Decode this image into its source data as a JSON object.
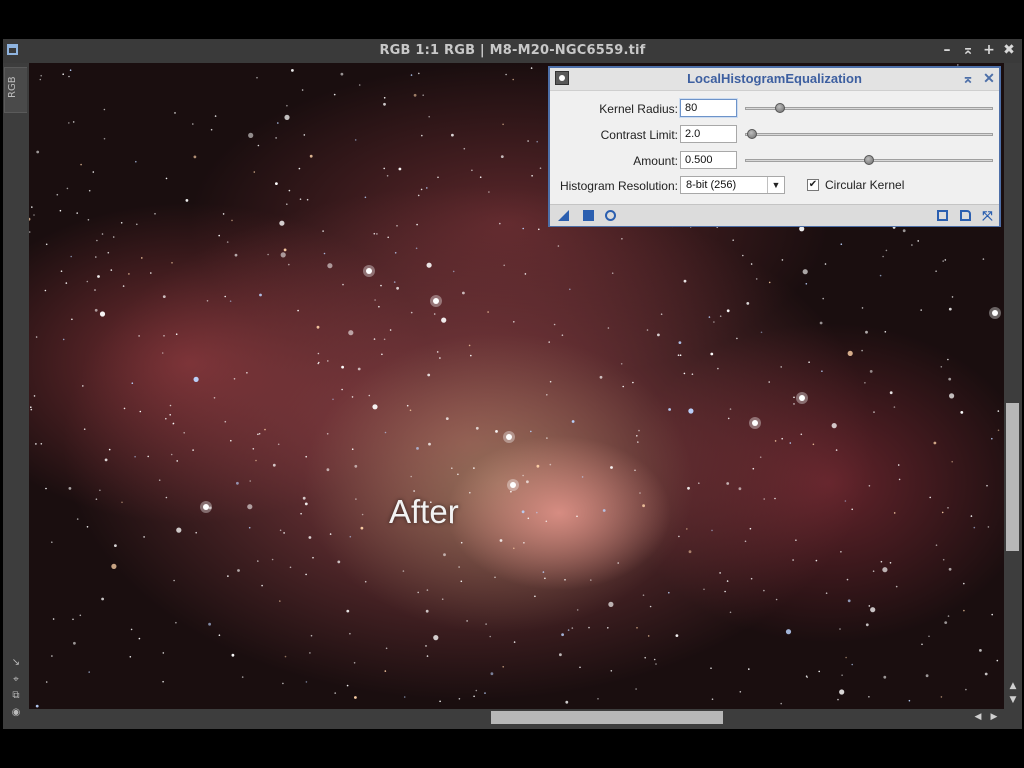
{
  "image_window": {
    "title": "RGB 1:1 RGB | M8-M20-NGC6559.tif",
    "view_tab": "RGB",
    "overlay_label": "After",
    "title_buttons": [
      "–",
      "≤",
      "+",
      "✖"
    ]
  },
  "dialog": {
    "title": "LocalHistogramEqualization",
    "kernel_radius": {
      "label": "Kernel Radius:",
      "value": "80",
      "slider_fraction": 0.14
    },
    "contrast_limit": {
      "label": "Contrast Limit:",
      "value": "2.0",
      "slider_fraction": 0.03
    },
    "amount": {
      "label": "Amount:",
      "value": "0.500",
      "slider_fraction": 0.5
    },
    "histogram_resolution": {
      "label": "Histogram Resolution:",
      "value": "8-bit (256)"
    },
    "circular_kernel": {
      "label": "Circular Kernel",
      "checked": true
    },
    "accent_color": "#2b5fb0"
  }
}
